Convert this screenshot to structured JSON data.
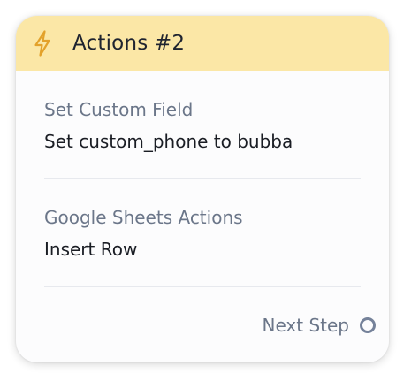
{
  "card": {
    "header": {
      "icon": "lightning-bolt-icon",
      "title": "Actions #2"
    },
    "actions": [
      {
        "label": "Set Custom Field",
        "value": "Set custom_phone to bubba"
      },
      {
        "label": "Google Sheets Actions",
        "value": "Insert Row"
      }
    ],
    "next_step_label": "Next Step"
  },
  "colors": {
    "header_background": "#fbe7a6",
    "icon_accent": "#e3a22b",
    "label": "#6b7689",
    "value": "#1a1d24",
    "connector_ring": "#75829a"
  }
}
